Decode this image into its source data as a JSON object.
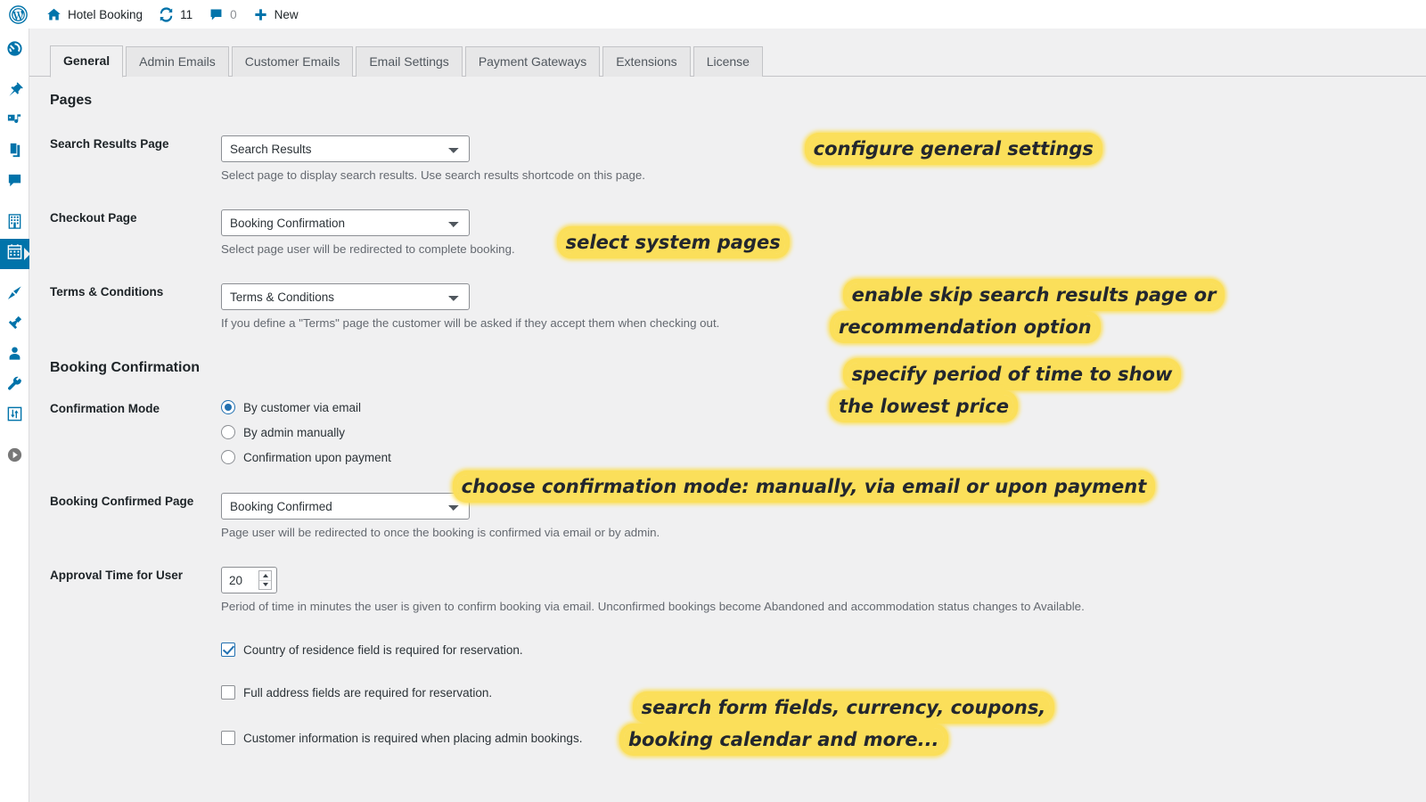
{
  "adminbar": {
    "wp_logo_icon": "wordpress-logo-icon",
    "site_icon": "home-icon",
    "site_name": "Hotel Booking",
    "updates_icon": "updates-sync-icon",
    "updates_count": "11",
    "comments_icon": "comment-bubble-icon",
    "comments_count": "0",
    "new_icon": "plus-icon",
    "new_label": "New"
  },
  "adminmenu": {
    "items": [
      {
        "icon": "dashboard-icon",
        "current": false
      },
      {
        "icon": "pin-posts-icon",
        "current": false
      },
      {
        "icon": "media-icon",
        "current": false
      },
      {
        "icon": "pages-icon",
        "current": false
      },
      {
        "icon": "comments-icon",
        "current": false
      },
      {
        "icon": "building-accommodations-icon",
        "current": false
      },
      {
        "icon": "calendar-bookings-icon",
        "current": true
      },
      {
        "icon": "appearance-brush-icon",
        "current": false
      },
      {
        "icon": "plugins-plug-icon",
        "current": false
      },
      {
        "icon": "users-icon",
        "current": false
      },
      {
        "icon": "tools-wrench-icon",
        "current": false
      },
      {
        "icon": "settings-sliders-icon",
        "current": false
      },
      {
        "icon": "collapse-menu-icon",
        "current": false
      }
    ]
  },
  "tabs": [
    {
      "label": "General",
      "active": true
    },
    {
      "label": "Admin Emails",
      "active": false
    },
    {
      "label": "Customer Emails",
      "active": false
    },
    {
      "label": "Email Settings",
      "active": false
    },
    {
      "label": "Payment Gateways",
      "active": false
    },
    {
      "label": "Extensions",
      "active": false
    },
    {
      "label": "License",
      "active": false
    }
  ],
  "sections": {
    "pages_title": "Pages",
    "booking_confirmation_title": "Booking Confirmation"
  },
  "fields": {
    "search_results_page": {
      "label": "Search Results Page",
      "value": "Search Results",
      "description": "Select page to display search results. Use search results shortcode on this page."
    },
    "checkout_page": {
      "label": "Checkout Page",
      "value": "Booking Confirmation",
      "description": "Select page user will be redirected to complete booking."
    },
    "terms_conditions": {
      "label": "Terms & Conditions",
      "value": "Terms & Conditions",
      "description": "If you define a \"Terms\" page the customer will be asked if they accept them when checking out."
    },
    "confirmation_mode": {
      "label": "Confirmation Mode",
      "options": [
        {
          "label": "By customer via email",
          "checked": true
        },
        {
          "label": "By admin manually",
          "checked": false
        },
        {
          "label": "Confirmation upon payment",
          "checked": false
        }
      ]
    },
    "booking_confirmed_page": {
      "label": "Booking Confirmed Page",
      "value": "Booking Confirmed",
      "description": "Page user will be redirected to once the booking is confirmed via email or by admin."
    },
    "approval_time": {
      "label": "Approval Time for User",
      "value": "20",
      "description": "Period of time in minutes the user is given to confirm booking via email. Unconfirmed bookings become Abandoned and accommodation status changes to Available."
    },
    "checkboxes": [
      {
        "label": "Country of residence field is required for reservation.",
        "checked": true
      },
      {
        "label": "Full address fields are required for reservation.",
        "checked": false
      },
      {
        "label": "Customer information is required when placing admin bookings.",
        "checked": false
      }
    ]
  },
  "annotations": [
    {
      "lines": [
        "configure general settings"
      ]
    },
    {
      "lines": [
        "select system pages"
      ]
    },
    {
      "lines": [
        "enable skip search results page or",
        "recommendation option"
      ]
    },
    {
      "lines": [
        "specify period of time to show",
        "the lowest price"
      ]
    },
    {
      "lines": [
        "choose confirmation mode: manually, via email or upon payment"
      ]
    },
    {
      "lines": [
        "search form fields, currency, coupons,",
        "booking calendar and more..."
      ]
    }
  ],
  "colors": {
    "wp_blue": "#0073aa",
    "admin_bg": "#f0f0f1",
    "highlight_yellow": "#fbdf5a",
    "accent_checked": "#2271b1"
  }
}
